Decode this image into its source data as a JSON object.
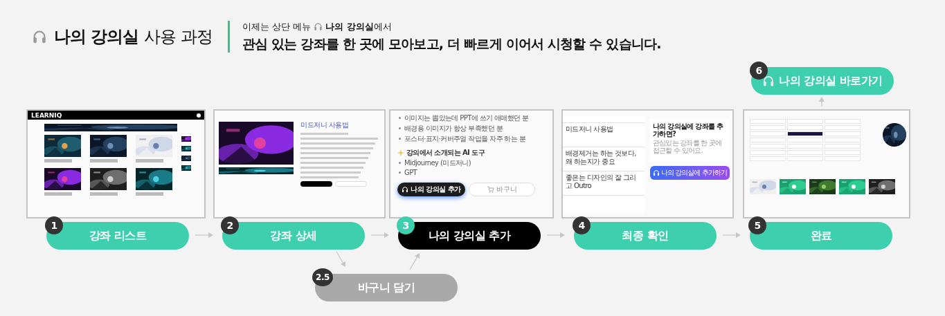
{
  "header": {
    "title": "나의 강의실",
    "title_suffix": "사용 과정",
    "notice": {
      "before": "이제는 상단 메뉴",
      "after": "**나의 강의실**에서"
    },
    "headline": "관심 있는 강좌를 한 곳에 모아보고, 더 빠르게 이어서 시청할 수 있습니다."
  },
  "shortcut": {
    "number": "6",
    "label": "나의 강의실 바로가기"
  },
  "screens": [
    {
      "kind": "list",
      "logo": "LEARNIQ"
    },
    {
      "kind": "detail",
      "title": "미드저니 사용법"
    },
    {
      "kind": "add",
      "audience": [
        "이미지는 뽑았는데 PPT에 쓰기 애매했던 분",
        "배경용 이미지가 항상 부족했던 분",
        "포스터·표지·커버주얼 작업을 자주 하는 분"
      ],
      "tools_heading": "강의에서 소개되는 AI 도구",
      "tools": [
        "Midjourney (미드저니)",
        "GPT"
      ],
      "add_button": "나의 강의실 추가",
      "cart_button": "바구니"
    },
    {
      "kind": "confirm",
      "items": [
        "미드저니 사용법",
        "배경제거는 하는 것보다, 왜 하는지가 중요",
        "좋은는 디자인의 잘 그리고 Outro"
      ],
      "popup": {
        "title": "나의 강의실에 강좌를 추가하면?",
        "description": "관심있는 강좌를 한 곳에 접근할 수 있어요.",
        "button": "나의 강의실에 추가하기"
      }
    },
    {
      "kind": "done"
    }
  ],
  "steps": [
    {
      "number": "1",
      "label": "강좌 리스트",
      "kind": "main"
    },
    {
      "number": "2",
      "label": "강좌 상세",
      "kind": "main"
    },
    {
      "number": "3",
      "label": "나의 강의실 추가",
      "kind": "highlight"
    },
    {
      "number": "4",
      "label": "최종 확인",
      "kind": "main"
    },
    {
      "number": "5",
      "label": "완료",
      "kind": "main"
    }
  ],
  "branch": {
    "number": "2.5",
    "label": "바구니 담기",
    "kind": "muted"
  }
}
